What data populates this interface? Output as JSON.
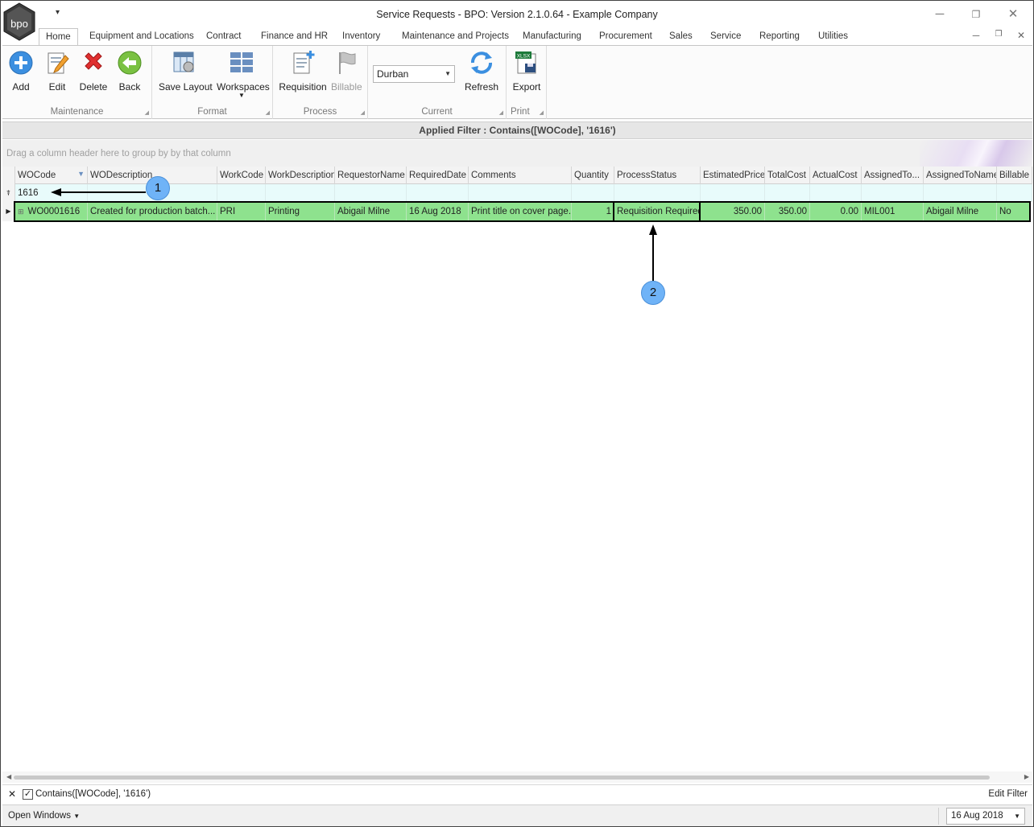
{
  "window": {
    "title": "Service Requests - BPO: Version 2.1.0.64 - Example Company",
    "logo_text": "bpo",
    "quick_access": "▾",
    "min_icon": "minimize-icon",
    "restore_icon": "restore-icon",
    "close_icon": "close-icon"
  },
  "tabs": [
    "Home",
    "Equipment and Locations",
    "Contract",
    "Finance and HR",
    "Inventory",
    "Maintenance and Projects",
    "Manufacturing",
    "Procurement",
    "Sales",
    "Service",
    "Reporting",
    "Utilities"
  ],
  "ribbon": {
    "maintenance": {
      "label": "Maintenance",
      "add": "Add",
      "edit": "Edit",
      "delete": "Delete",
      "back": "Back"
    },
    "format": {
      "label": "Format",
      "save_layout": "Save Layout",
      "workspaces": "Workspaces"
    },
    "process": {
      "label": "Process",
      "requisition": "Requisition",
      "billable": "Billable"
    },
    "current": {
      "label": "Current",
      "site": "Durban",
      "refresh": "Refresh"
    },
    "print": {
      "label": "Print",
      "export": "Export",
      "xlsx": "XLSX"
    }
  },
  "applied_filter": "Applied Filter : Contains([WOCode], '1616')",
  "group_panel": "Drag a column header here to group by by that column",
  "grid": {
    "columns": [
      "WOCode",
      "WODescription",
      "WorkCode",
      "WorkDescription",
      "RequestorName",
      "RequiredDate",
      "Comments",
      "Quantity",
      "ProcessStatus",
      "EstimatedPrice",
      "TotalCost",
      "ActualCost",
      "AssignedTo...",
      "AssignedToName",
      "Billable"
    ],
    "filter_value": "1616",
    "row": [
      "WO0001616",
      "Created for production batch...",
      "PRI",
      "Printing",
      "Abigail Milne",
      "16 Aug 2018",
      "Print title on cover page.",
      "1",
      "Requisition Required",
      "350.00",
      "350.00",
      "0.00",
      "MIL001",
      "Abigail Milne",
      "No"
    ],
    "row_color": "#8ee28e"
  },
  "callouts": {
    "one": "1",
    "two": "2",
    "color": "#6fb3f7"
  },
  "filter_bar": {
    "text": "Contains([WOCode], '1616')",
    "edit": "Edit Filter",
    "checked": "✓"
  },
  "status": {
    "open_windows": "Open Windows",
    "date": "16 Aug 2018"
  }
}
